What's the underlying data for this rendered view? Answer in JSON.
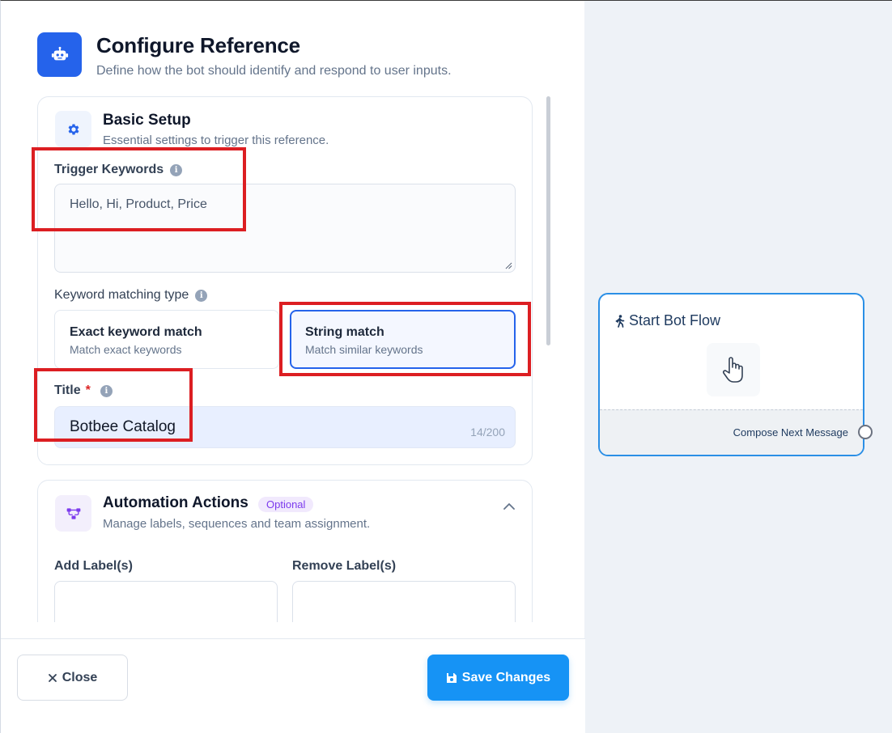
{
  "header": {
    "title": "Configure Reference",
    "subtitle": "Define how the bot should identify and respond to user inputs.",
    "icon": "robot-icon",
    "accent": "#2563eb"
  },
  "basic_setup": {
    "title": "Basic Setup",
    "subtitle": "Essential settings to trigger this reference.",
    "icon": "gear-icon",
    "trigger_keywords": {
      "label": "Trigger Keywords",
      "value": "Hello, Hi, Product, Price"
    },
    "matching": {
      "label": "Keyword matching type",
      "options": [
        {
          "title": "Exact keyword match",
          "subtitle": "Match exact keywords",
          "selected": false
        },
        {
          "title": "String match",
          "subtitle": "Match similar keywords",
          "selected": true
        }
      ]
    },
    "title_field": {
      "label": "Title",
      "required_mark": "*",
      "value": "Botbee Catalog",
      "char_count": "14/200"
    }
  },
  "automation": {
    "title": "Automation Actions",
    "badge": "Optional",
    "subtitle": "Manage labels, sequences and team assignment.",
    "icon": "flow-icon",
    "add_label": "Add Label(s)",
    "remove_label": "Remove Label(s)",
    "expanded": true
  },
  "footer": {
    "close_label": "Close",
    "save_label": "Save Changes",
    "save_color": "#1693f5"
  },
  "flow_node": {
    "title": "Start Bot Flow",
    "icon": "walking-person-icon",
    "footer_label": "Compose Next Message",
    "border_color": "#2b8fe6"
  },
  "highlight_color": "#dc1e22"
}
